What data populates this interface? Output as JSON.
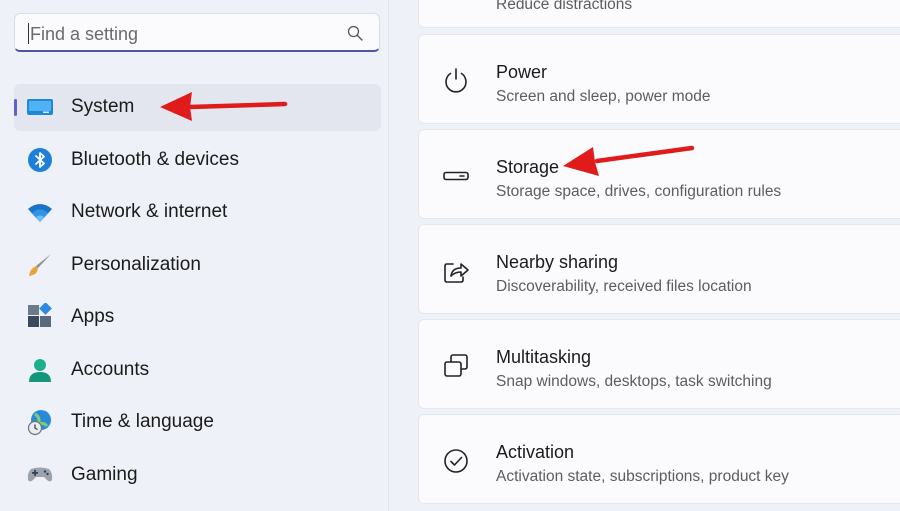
{
  "search": {
    "placeholder": "Find a setting",
    "icon": "search-icon"
  },
  "sidebar": {
    "items": [
      {
        "label": "System",
        "icon": "system-display-icon",
        "active": true
      },
      {
        "label": "Bluetooth & devices",
        "icon": "bluetooth-icon"
      },
      {
        "label": "Network & internet",
        "icon": "wifi-icon"
      },
      {
        "label": "Personalization",
        "icon": "paintbrush-icon"
      },
      {
        "label": "Apps",
        "icon": "apps-icon"
      },
      {
        "label": "Accounts",
        "icon": "account-icon"
      },
      {
        "label": "Time & language",
        "icon": "globe-clock-icon"
      },
      {
        "label": "Gaming",
        "icon": "gamepad-icon"
      }
    ]
  },
  "main": {
    "top_partial_text": "Reduce distractions",
    "cards": [
      {
        "title": "Power",
        "subtitle": "Screen and sleep, power mode",
        "icon": "power-icon"
      },
      {
        "title": "Storage",
        "subtitle": "Storage space, drives, configuration rules",
        "icon": "storage-drive-icon"
      },
      {
        "title": "Nearby sharing",
        "subtitle": "Discoverability, received files location",
        "icon": "share-icon"
      },
      {
        "title": "Multitasking",
        "subtitle": "Snap windows, desktops, task switching",
        "icon": "multitasking-icon"
      },
      {
        "title": "Activation",
        "subtitle": "Activation state, subscriptions, product key",
        "icon": "activation-check-icon"
      }
    ]
  },
  "colors": {
    "accent": "#5865c2",
    "annotation_arrow": "#e01b1b",
    "background": "#eef1f8",
    "card": "#fbfbfd"
  }
}
